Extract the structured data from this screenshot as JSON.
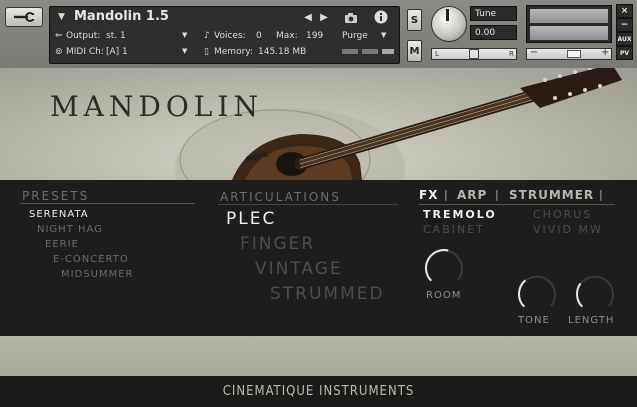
{
  "header": {
    "instrument_name": "Mandolin 1.5",
    "output_label": "Output:",
    "output_value": "st. 1",
    "voices_label": "Voices:",
    "voices_value": "0",
    "max_label": "Max:",
    "max_value": "199",
    "purge_label": "Purge",
    "midi_label": "MIDI Ch:",
    "midi_value": "[A]  1",
    "memory_label": "Memory:",
    "memory_value": "145.18 MB",
    "solo_label": "S",
    "mute_label": "M",
    "tune_label": "Tune",
    "tune_value": "0.00",
    "pan_left": "L",
    "pan_right": "R",
    "aux_label": "AUX",
    "pv_label": "PV",
    "close_label": "×",
    "minimize_label": "−",
    "vol_minus": "−",
    "vol_plus": "+"
  },
  "hero": {
    "title": "MANDOLIN"
  },
  "presets": {
    "heading": "PRESETS",
    "items": [
      "SERENATA",
      "NIGHT HAG",
      "EERIE",
      "E-CONCERTO",
      "MIDSUMMER"
    ],
    "selected": "SERENATA"
  },
  "articulations": {
    "heading": "ARTICULATIONS",
    "items": [
      "PLEC",
      "FINGER",
      "VINTAGE",
      "STRUMMED"
    ],
    "selected": "PLEC"
  },
  "fx": {
    "tabs": [
      "FX",
      "ARP",
      "STRUMMER"
    ],
    "separator": "|",
    "options": [
      "TREMOLO",
      "CHORUS",
      "CABINET",
      "VIVID MW"
    ],
    "selected": "TREMOLO",
    "knobs": [
      {
        "label": "ROOM",
        "value": 0.55
      },
      {
        "label": "TONE",
        "value": 0.35
      },
      {
        "label": "LENGTH",
        "value": 0.3
      }
    ]
  },
  "footer": {
    "brand": "CINEMATIQUE INSTRUMENTS"
  },
  "colors": {
    "accent_selected": "#f0f0f0",
    "muted_text": "#4d4d4a",
    "panel_bg": "#1d1d1c"
  }
}
